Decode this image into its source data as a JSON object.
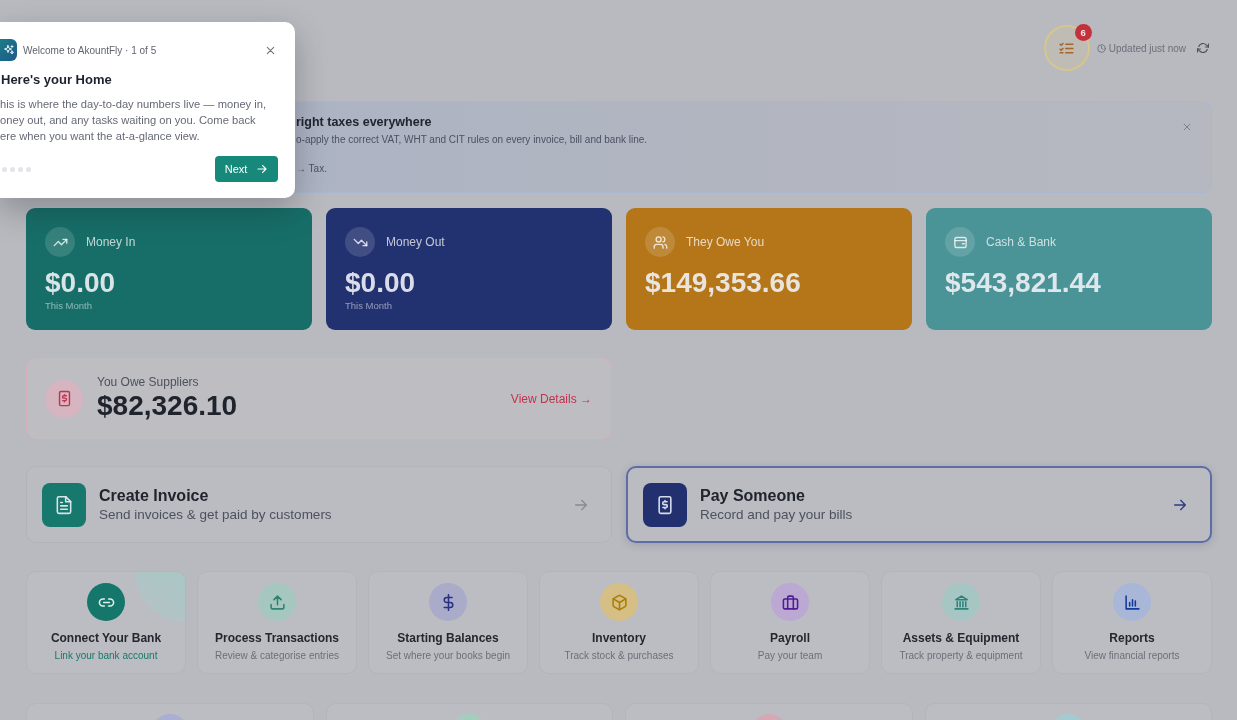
{
  "tour": {
    "header": "Welcome to AkountFly · 1 of 5",
    "title": "Here's your Home",
    "body": "his is where the day-to-day numbers live — money in,\noney out, and any tasks waiting on you. Come back\nere when you want the at-a-glance view.",
    "steps": [
      {
        "selected": false
      },
      {
        "selected": false
      },
      {
        "selected": false
      },
      {
        "selected": false
      }
    ],
    "next_button": "Next"
  },
  "header": {
    "tasks_badge": "6",
    "updated": "Updated just now"
  },
  "banner": {
    "title": "right taxes everywhere",
    "lines": [
      "o-apply the correct VAT, WHT and CIT rules on every invoice, bill and bank line.",
      "→ Tax."
    ]
  },
  "stat_cards": [
    {
      "label": "Money In",
      "value": "$0.00",
      "period": "This Month",
      "color": "#176e68"
    },
    {
      "label": "Money Out",
      "value": "$0.00",
      "period": "This Month",
      "color": "#223170"
    },
    {
      "label": "They Owe You",
      "value": "$149,353.66",
      "color": "#b47619"
    },
    {
      "label": "Cash & Bank",
      "value": "$543,821.44",
      "color": "#4a9397"
    }
  ],
  "payables": {
    "label": "You Owe Suppliers",
    "value": "$82,326.10",
    "link": "View Details →"
  },
  "actions": [
    {
      "title": "Create Invoice",
      "subtitle": "Send invoices & get paid by customers",
      "color": "#17786d",
      "selected": false
    },
    {
      "title": "Pay Someone",
      "subtitle": "Record and pay your bills",
      "color": "#22306f",
      "selected": true
    }
  ],
  "quick_links": [
    {
      "kind": "primary",
      "title": "Connect Your Bank",
      "subtitle": "Link your bank account",
      "color": "#15766b"
    },
    {
      "kind": "default",
      "title": "Process Transactions",
      "subtitle": "Review & categorise entries",
      "color": "#a6c7c0"
    },
    {
      "kind": "default",
      "title": "Starting Balances",
      "subtitle": "Set where your books begin",
      "color": "#a9abc9"
    },
    {
      "kind": "default",
      "title": "Inventory",
      "subtitle": "Track stock & purchases",
      "color": "#d5bf85"
    },
    {
      "kind": "default",
      "title": "Payroll",
      "subtitle": "Pay your team",
      "color": "#bba8d3"
    },
    {
      "kind": "default",
      "title": "Assets & Equipment",
      "subtitle": "Track property & equipment",
      "color": "#a6c6c3"
    },
    {
      "kind": "default",
      "title": "Reports",
      "subtitle": "View financial reports",
      "color": "#a8b6d8"
    }
  ],
  "more_cards": [
    {
      "color": "#a9aed2"
    },
    {
      "color": "#a5cdbd"
    },
    {
      "color": "#d5a8b6"
    },
    {
      "color": "#a4cbd0"
    }
  ]
}
